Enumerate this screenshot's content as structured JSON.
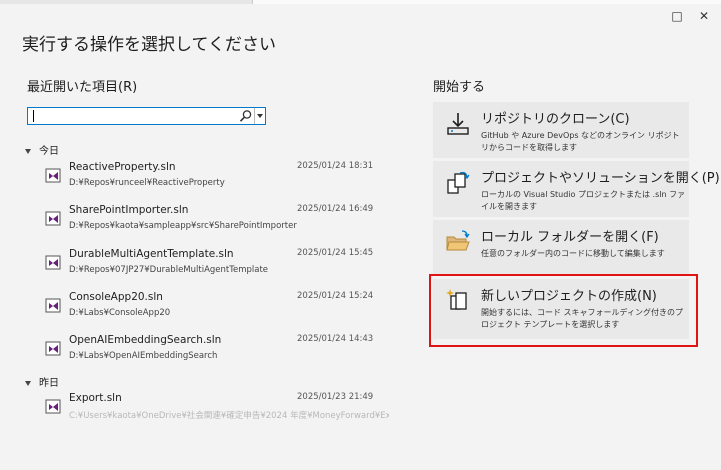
{
  "dialog": {
    "title": "実行する操作を選択してください"
  },
  "recent": {
    "heading": "最近開いた項目(R)",
    "search": {
      "value": "",
      "placeholder": ""
    },
    "groups": [
      {
        "label": "今日",
        "items": [
          {
            "name": "ReactiveProperty.sln",
            "path": "D:¥Repos¥runceel¥ReactiveProperty",
            "date": "2025/01/24 18:31"
          },
          {
            "name": "SharePointImporter.sln",
            "path": "D:¥Repos¥kaota¥sampleapp¥src¥SharePointImporter",
            "date": "2025/01/24 16:49"
          },
          {
            "name": "DurableMultiAgentTemplate.sln",
            "path": "D:¥Repos¥07JP27¥DurableMultiAgentTemplate",
            "date": "2025/01/24 15:45"
          },
          {
            "name": "ConsoleApp20.sln",
            "path": "D:¥Labs¥ConsoleApp20",
            "date": "2025/01/24 15:24"
          },
          {
            "name": "OpenAIEmbeddingSearch.sln",
            "path": "D:¥Labs¥OpenAIEmbeddingSearch",
            "date": "2025/01/24 14:43"
          }
        ]
      },
      {
        "label": "昨日",
        "items": [
          {
            "name": "Export.sln",
            "path": "C:¥Users¥kaota¥OneDrive¥社会関連¥確定申告¥2024 年度¥MoneyForward¥Ex",
            "date": "2025/01/23 21:49"
          }
        ]
      }
    ]
  },
  "start": {
    "heading": "開始する",
    "cards": [
      {
        "icon": "clone-repo-icon",
        "title": "リポジトリのクローン(C)",
        "desc": "GitHub や Azure DevOps などのオンライン リポジトリからコードを取得します"
      },
      {
        "icon": "open-project-icon",
        "title": "プロジェクトやソリューションを開く(P)",
        "desc": "ローカルの Visual Studio プロジェクトまたは .sln ファイルを開きます"
      },
      {
        "icon": "open-folder-icon",
        "title": "ローカル フォルダーを開く(F)",
        "desc": "任意のフォルダー内のコードに移動して編集します"
      },
      {
        "icon": "new-project-icon",
        "title": "新しいプロジェクトの作成(N)",
        "desc": "開始するには、コード スキャフォールディング付きのプロジェクト テンプレートを選択します"
      }
    ]
  },
  "window": {
    "maximize": "□",
    "close": "✕"
  },
  "colors": {
    "highlight": "#e01414",
    "accent": "#007acc",
    "vs_purple": "#68217a"
  }
}
